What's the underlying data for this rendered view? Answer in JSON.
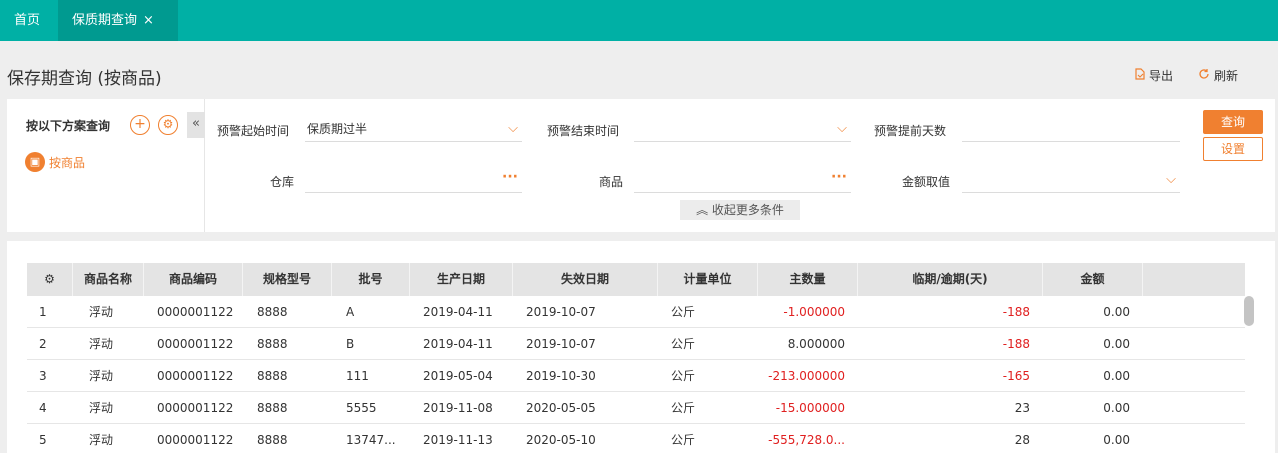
{
  "tabs": {
    "home": "首页",
    "active": "保质期查询",
    "close": "×"
  },
  "page": {
    "title": "保存期查询 (按商品)",
    "export_label": "导出",
    "refresh_label": "刷新"
  },
  "scheme": {
    "label": "按以下方案查询",
    "add": "+",
    "gear": "⚙",
    "collapse": "«",
    "item": "按商品",
    "item_icon": "▣"
  },
  "filters": {
    "warn_start_label": "预警起始时间",
    "warn_start_value": "保质期过半",
    "warn_end_label": "预警结束时间",
    "warn_end_value": "",
    "advance_days_label": "预警提前天数",
    "advance_days_value": "",
    "warehouse_label": "仓库",
    "warehouse_value": "",
    "product_label": "商品",
    "product_value": "",
    "amount_label": "金额取值",
    "amount_value": "",
    "more_toggle": "收起更多条件",
    "chevron": "⌵",
    "dots": "···",
    "more_icon": "︽"
  },
  "buttons": {
    "query": "查询",
    "settings": "设置"
  },
  "accent_color": "#f08030",
  "topbar_color": "#00b0a5",
  "table": {
    "settings_icon": "⚙",
    "columns": [
      "商品名称",
      "商品编码",
      "规格型号",
      "批号",
      "生产日期",
      "失效日期",
      "计量单位",
      "主数量",
      "临期/逾期(天)",
      "金额"
    ],
    "rows": [
      {
        "idx": "1",
        "name": "浮动",
        "code": "0000001122",
        "spec": "8888",
        "batch": "A",
        "mfg": "2019-04-11",
        "exp": "2019-10-07",
        "unit": "公斤",
        "qty": "-1.000000",
        "days": "-188",
        "amount": "0.00"
      },
      {
        "idx": "2",
        "name": "浮动",
        "code": "0000001122",
        "spec": "8888",
        "batch": "B",
        "mfg": "2019-04-11",
        "exp": "2019-10-07",
        "unit": "公斤",
        "qty": "8.000000",
        "days": "-188",
        "amount": "0.00"
      },
      {
        "idx": "3",
        "name": "浮动",
        "code": "0000001122",
        "spec": "8888",
        "batch": "111",
        "mfg": "2019-05-04",
        "exp": "2019-10-30",
        "unit": "公斤",
        "qty": "-213.000000",
        "days": "-165",
        "amount": "0.00"
      },
      {
        "idx": "4",
        "name": "浮动",
        "code": "0000001122",
        "spec": "8888",
        "batch": "5555",
        "mfg": "2019-11-08",
        "exp": "2020-05-05",
        "unit": "公斤",
        "qty": "-15.000000",
        "days": "23",
        "amount": "0.00"
      },
      {
        "idx": "5",
        "name": "浮动",
        "code": "0000001122",
        "spec": "8888",
        "batch": "13747...",
        "mfg": "2019-11-13",
        "exp": "2020-05-10",
        "unit": "公斤",
        "qty": "-555,728.0...",
        "days": "28",
        "amount": "0.00"
      }
    ]
  }
}
